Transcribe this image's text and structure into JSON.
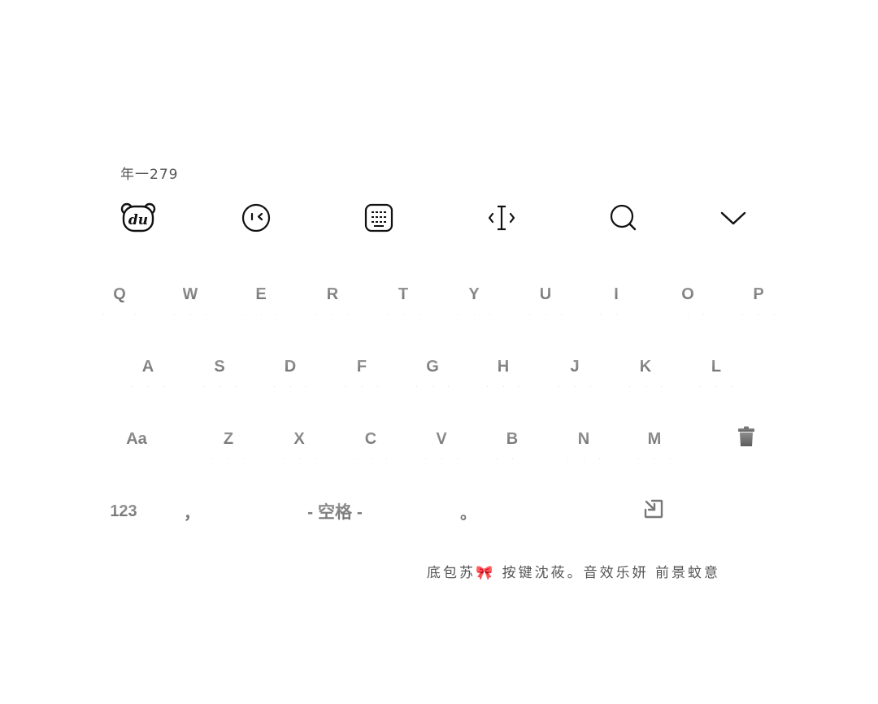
{
  "candidate": {
    "text": "年一279"
  },
  "toolbar": {
    "icons": [
      "du-bear-logo-icon",
      "emoji-wink-icon",
      "keyboard-layout-icon",
      "cursor-move-icon",
      "search-icon",
      "collapse-chevron-icon"
    ]
  },
  "keyboard": {
    "row1": [
      "Q",
      "W",
      "E",
      "R",
      "T",
      "Y",
      "U",
      "I",
      "O",
      "P"
    ],
    "row2": [
      "A",
      "S",
      "D",
      "F",
      "G",
      "H",
      "J",
      "K",
      "L"
    ],
    "row3": {
      "shift": "Aa",
      "letters": [
        "Z",
        "X",
        "C",
        "V",
        "B",
        "N",
        "M"
      ],
      "delete_icon": "trash-icon"
    },
    "row4": {
      "numbers": "123",
      "comma": "，",
      "space": "- 空格 -",
      "period": "。",
      "enter_icon": "enter-arrow-icon"
    }
  },
  "caption": {
    "text": "底包苏🎀 按键沈莜。音效乐妍 前景蚊意"
  },
  "colors": {
    "key_text": "#7a7a7a",
    "icon_stroke": "#111111",
    "caption": "#555555"
  }
}
